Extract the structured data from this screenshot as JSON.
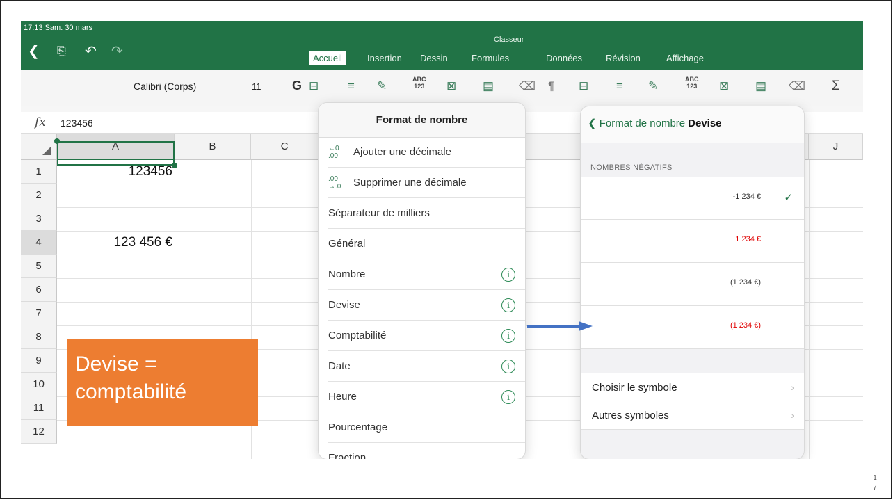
{
  "status": {
    "time_date": "17:13  Sam. 30 mars"
  },
  "app": {
    "doc_title": "Classeur"
  },
  "nav": {
    "back": "❮",
    "file": "⎘",
    "undo": "↶",
    "redo": "↷"
  },
  "tabs": [
    "Accueil",
    "Insertion",
    "Dessin",
    "Formules",
    "Données",
    "Révision",
    "Affichage"
  ],
  "ribbon": {
    "font_name": "Calibri (Corps)",
    "font_size": "11",
    "bold": "G",
    "abc_line1": "ABC",
    "abc_line2": "123",
    "sigma": "Σ",
    "pilcrow": "¶"
  },
  "formula": {
    "fx": "fx",
    "value": "123456"
  },
  "grid": {
    "columns": [
      "A",
      "B",
      "C",
      "J"
    ],
    "rows": [
      "1",
      "2",
      "3",
      "4",
      "5",
      "6",
      "7",
      "8",
      "9",
      "10",
      "11",
      "12"
    ],
    "cells": {
      "A1": "123456",
      "A4": "123 456 €"
    }
  },
  "callout": {
    "line1": "Devise =",
    "line2": "comptabilité"
  },
  "format_menu": {
    "title": "Format de nombre",
    "add_decimal": "Ajouter une décimale",
    "remove_decimal": "Supprimer une décimale",
    "add_icon": "←0\n.00",
    "remove_icon": ".00\n→.0",
    "items": [
      "Séparateur de milliers",
      "Général",
      "Nombre",
      "Devise",
      "Comptabilité",
      "Date",
      "Heure",
      "Pourcentage",
      "Fraction"
    ],
    "info_symbol": "i"
  },
  "currency_panel": {
    "back_label": "Format de nombre",
    "title": "Devise",
    "section": "NOMBRES NÉGATIFS",
    "options": [
      "-1 234 €",
      "1 234 €",
      "(1 234 €)",
      "(1 234 €)"
    ],
    "check": "✓",
    "choose_symbol": "Choisir le symbole",
    "other_symbols": "Autres symboles",
    "chevron": "›"
  },
  "page_number": {
    "line1": "1",
    "line2": "7"
  },
  "colors": {
    "excel_green": "#217346",
    "callout_orange": "#ED7D31",
    "arrow_blue": "#4472C4",
    "negative_red": "#E00000"
  }
}
